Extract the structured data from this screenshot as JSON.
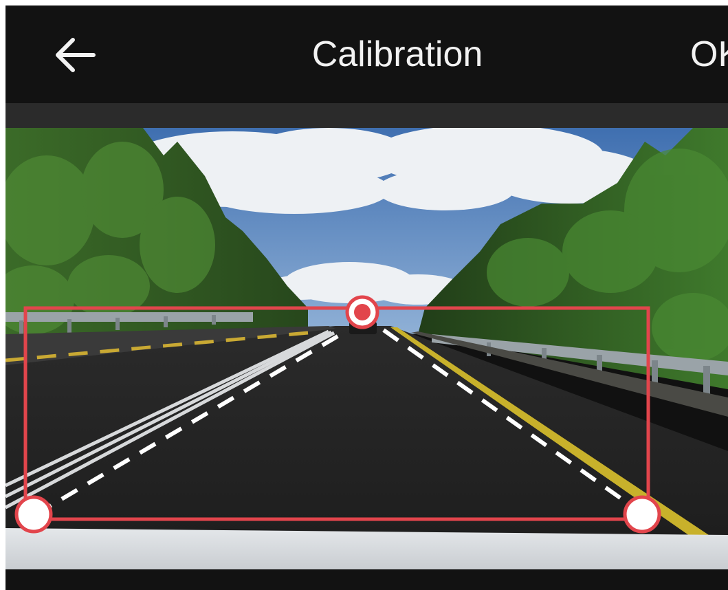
{
  "header": {
    "title": "Calibration",
    "ok_label": "OK"
  },
  "icons": {
    "back": "arrow-left-icon"
  },
  "colors": {
    "appbar": "#121212",
    "accent_red": "#e2454c",
    "handle_fill": "#ffffff",
    "guide_line": "#ffffff"
  }
}
